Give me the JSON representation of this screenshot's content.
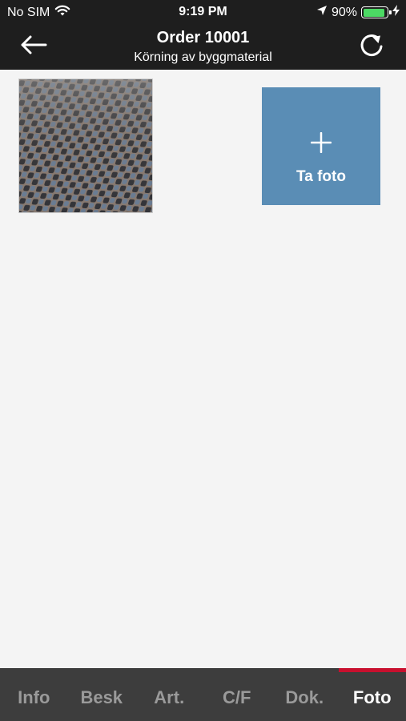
{
  "status_bar": {
    "carrier": "No SIM",
    "time": "9:19 PM",
    "battery_percent": "90%",
    "battery_level": 0.9
  },
  "nav": {
    "title": "Order 10001",
    "subtitle": "Körning av byggmaterial",
    "back_icon": "arrow-left-icon",
    "refresh_icon": "refresh-icon"
  },
  "photos": {
    "add_label": "Ta foto",
    "accent_color": "#5a8db5"
  },
  "tabs": [
    {
      "label": "Info",
      "active": false
    },
    {
      "label": "Besk",
      "active": false
    },
    {
      "label": "Art.",
      "active": false
    },
    {
      "label": "C/F",
      "active": false
    },
    {
      "label": "Dok.",
      "active": false
    },
    {
      "label": "Foto",
      "active": true
    }
  ],
  "colors": {
    "header_bg": "#1e1e1e",
    "tab_bar_bg": "#3d3d3d",
    "active_indicator": "#c8102e"
  }
}
